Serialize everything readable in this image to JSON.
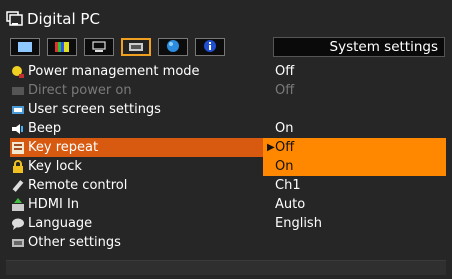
{
  "header": {
    "title": "Digital PC",
    "section": "System settings"
  },
  "tabs": [
    {
      "icon": "image-adjust-icon"
    },
    {
      "icon": "color-bars-icon"
    },
    {
      "icon": "projector-settings-icon"
    },
    {
      "icon": "system-settings-icon",
      "active": true
    },
    {
      "icon": "network-globe-icon"
    },
    {
      "icon": "info-icon"
    }
  ],
  "menu": {
    "items": [
      {
        "label": "Power management mode",
        "value": "Off",
        "icon": "power-bulb-icon"
      },
      {
        "label": "Direct power on",
        "value": "Off",
        "icon": "direct-power-icon",
        "disabled": true
      },
      {
        "label": "User screen settings",
        "value": "",
        "icon": "user-screen-icon"
      },
      {
        "label": "Beep",
        "value": "On",
        "icon": "speaker-icon"
      },
      {
        "label": "Key repeat",
        "value": "Off",
        "icon": "key-repeat-icon",
        "selected": true
      },
      {
        "label": "Key lock",
        "value": "On",
        "icon": "lock-icon"
      },
      {
        "label": "Remote control",
        "value": "Ch1",
        "icon": "remote-icon"
      },
      {
        "label": "HDMI In",
        "value": "Auto",
        "icon": "hdmi-icon"
      },
      {
        "label": "Language",
        "value": "English",
        "icon": "speech-bubble-icon"
      },
      {
        "label": "Other settings",
        "value": "",
        "icon": "keyboard-icon"
      }
    ]
  },
  "popup": {
    "options": [
      "Off",
      "On"
    ],
    "selected": "Off"
  },
  "colors": {
    "selected_row": "#d85a10",
    "popup_option": "#ff8800",
    "active_tab_border": "#f0a020"
  }
}
